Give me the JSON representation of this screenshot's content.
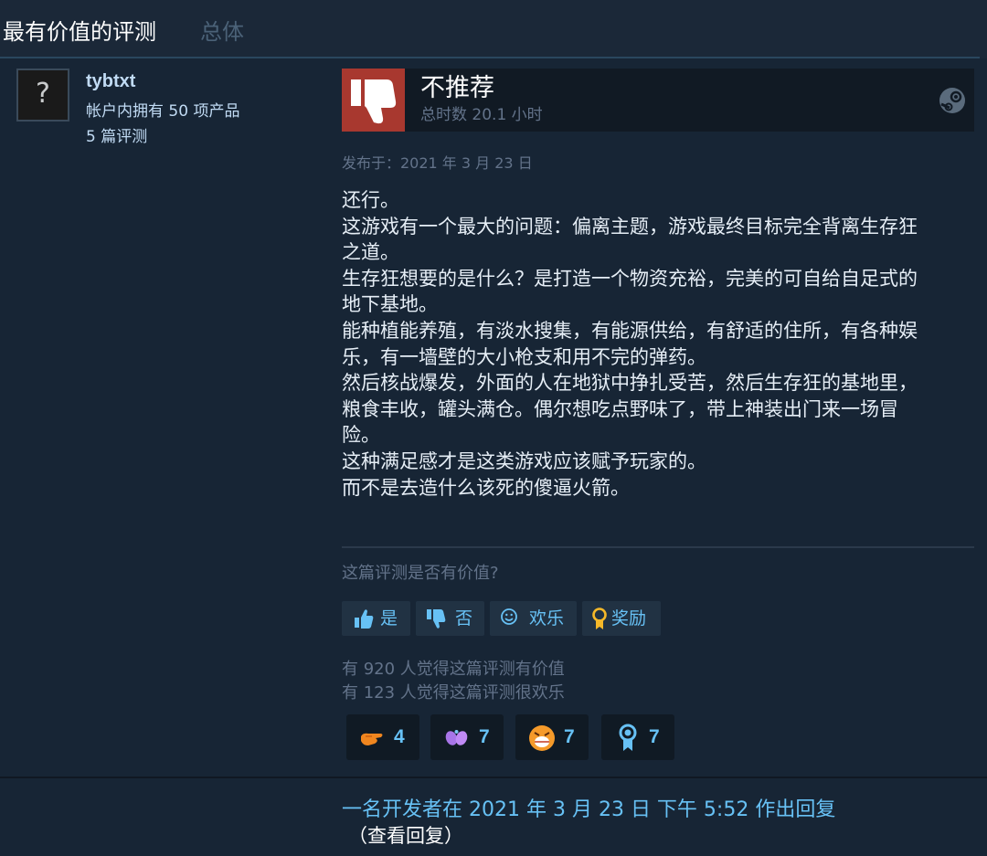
{
  "header": {
    "title": "最有价值的评测",
    "tab": "总体"
  },
  "user": {
    "avatar_placeholder": "?",
    "name": "tybtxt",
    "products": "帐户内拥有 50 项产品",
    "reviews": "5 篇评测"
  },
  "verdict": {
    "title": "不推荐",
    "hours": "总时数 20.1 小时",
    "icon": "thumbs-down-icon",
    "color": "#a8382f"
  },
  "posted": "发布于：2021 年 3 月 23 日",
  "review_lines": [
    "还行。",
    "这游戏有一个最大的问题：偏离主题，游戏最终目标完全背离生存狂",
    "之道。",
    "生存狂想要的是什么？是打造一个物资充裕，完美的可自给自足式的",
    "地下基地。",
    "能种植能养殖，有淡水搜集，有能源供给，有舒适的住所，有各种娱",
    "乐，有一墙壁的大小枪支和用不完的弹药。",
    "然后核战爆发，外面的人在地狱中挣扎受苦，然后生存狂的基地里，",
    "粮食丰收，罐头满仓。偶尔想吃点野味了，带上神装出门来一场冒",
    "险。",
    "这种满足感才是这类游戏应该赋予玩家的。",
    "而不是去造什么该死的傻逼火箭。"
  ],
  "helpful": {
    "question": "这篇评测是否有价值?",
    "buttons": {
      "yes": "是",
      "no": "否",
      "funny": "欢乐",
      "award": "奖励"
    }
  },
  "stats": {
    "helpful": "有 920 人觉得这篇评测有价值",
    "funny": "有 123 人觉得这篇评测很欢乐"
  },
  "awards": [
    {
      "icon": "pointing-hand-icon",
      "count": "4"
    },
    {
      "icon": "purple-hands-icon",
      "count": "7"
    },
    {
      "icon": "laughing-face-icon",
      "count": "7"
    },
    {
      "icon": "ribbon-medal-icon",
      "count": "7"
    }
  ],
  "dev_reply": {
    "link": "一名开发者在 2021 年 3 月 23 日 下午 5:52 作出回复",
    "view": "（查看回复）"
  },
  "colors": {
    "background": "#1b2838",
    "link": "#67c1f5",
    "muted": "#63738a"
  }
}
